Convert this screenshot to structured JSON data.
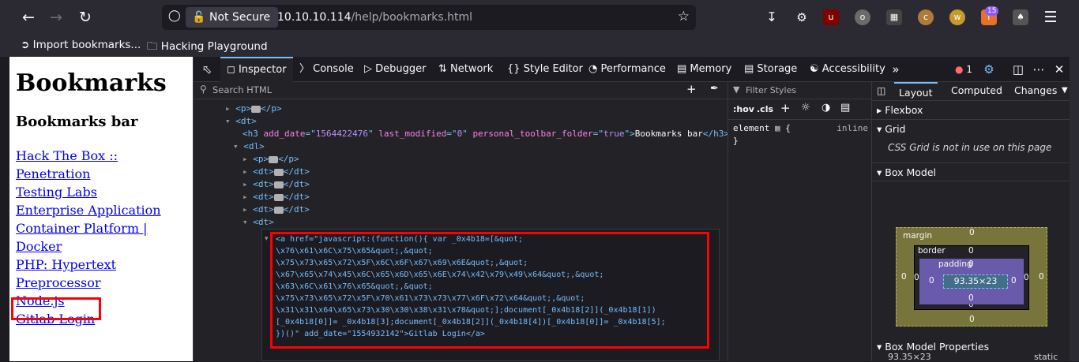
{
  "browser": {
    "not_secure_label": "Not Secure",
    "url_host": "10.10.10.114",
    "url_path": "/help/bookmarks.html",
    "extension_badge": "15",
    "bookmarks": [
      "Import bookmarks...",
      "Hacking Playground"
    ]
  },
  "page": {
    "title": "Bookmarks",
    "subtitle": "Bookmarks bar",
    "links": [
      "Hack The Box :: Penetration",
      "Testing Labs",
      "Enterprise Application",
      "Container Platform  |",
      "Docker",
      "PHP: Hypertext",
      "Preprocessor",
      "Node.js",
      "Gitlab Login"
    ]
  },
  "devtools": {
    "tabs": [
      "Inspector",
      "Console",
      "Debugger",
      "Network",
      "Style Editor",
      "Performance",
      "Memory",
      "Storage",
      "Accessibility"
    ],
    "error_count": "1",
    "search_placeholder": "Search HTML",
    "filter_placeholder": "Filter Styles",
    "rule_toggles": [
      ":hov",
      ".cls"
    ],
    "element_rule": "element",
    "element_rule_open": "{",
    "element_rule_close": "}",
    "inline_label": "inline",
    "markup_lines": [
      {
        "tag_open": "<p>",
        "tag_close": "</p>"
      },
      {
        "tag": "<dt>"
      },
      {
        "h3": "Bookmarks bar",
        "add_date": "1564422476",
        "last_modified": "0",
        "personal_toolbar_folder": "true"
      },
      {
        "tag": "<dl>"
      },
      {
        "tag_open": "<p>",
        "tag_close": "</p>"
      },
      {
        "tag_open": "<dt>",
        "tag_close": "</dt>"
      },
      {
        "tag_open": "<dt>",
        "tag_close": "</dt>"
      },
      {
        "tag_open": "<dt>",
        "tag_close": "</dt>"
      },
      {
        "tag_open": "<dt>",
        "tag_close": "</dt>"
      },
      {
        "tag": "<dt>"
      }
    ],
    "selected_node": [
      "<a href=\"javascript:(function(){ var _0x4b18=[&quot;",
      "\\x76\\x61\\x6C\\x75\\x65&quot;,&quot;",
      "\\x75\\x73\\x65\\x72\\x5F\\x6C\\x6F\\x67\\x69\\x6E&quot;,&quot;",
      "\\x67\\x65\\x74\\x45\\x6C\\x65\\x6D\\x65\\x6E\\x74\\x42\\x79\\x49\\x64&quot;,&quot;",
      "\\x63\\x6C\\x61\\x76\\x65&quot;,&quot;",
      "\\x75\\x73\\x65\\x72\\x5F\\x70\\x61\\x73\\x73\\x77\\x6F\\x72\\x64&quot;,&quot;",
      "\\x31\\x31\\x64\\x65\\x73\\x30\\x30\\x38\\x31\\x78&quot;];document[_0x4b18[2]](_0x4b18[1])",
      "[_0x4b18[0]]= _0x4b18[3];document[_0x4b18[2]](_0x4b18[4])[_0x4b18[0]]= _0x4b18[5];",
      "})()\" add_date=\"1554932142\">Gitlab Login</a>"
    ],
    "layout_tabs": [
      "Layout",
      "Computed",
      "Changes"
    ],
    "sections": [
      "Flexbox",
      "Grid",
      "Box Model"
    ],
    "grid_note": "CSS Grid is not in use on this page",
    "box_model": {
      "margin_label": "margin",
      "border_label": "border",
      "padding_label": "padding",
      "content": "93.35×23",
      "zero": "0"
    },
    "size_readout": "93.35×23",
    "position_readout": "static",
    "box_props_label": "Box Model Properties"
  }
}
